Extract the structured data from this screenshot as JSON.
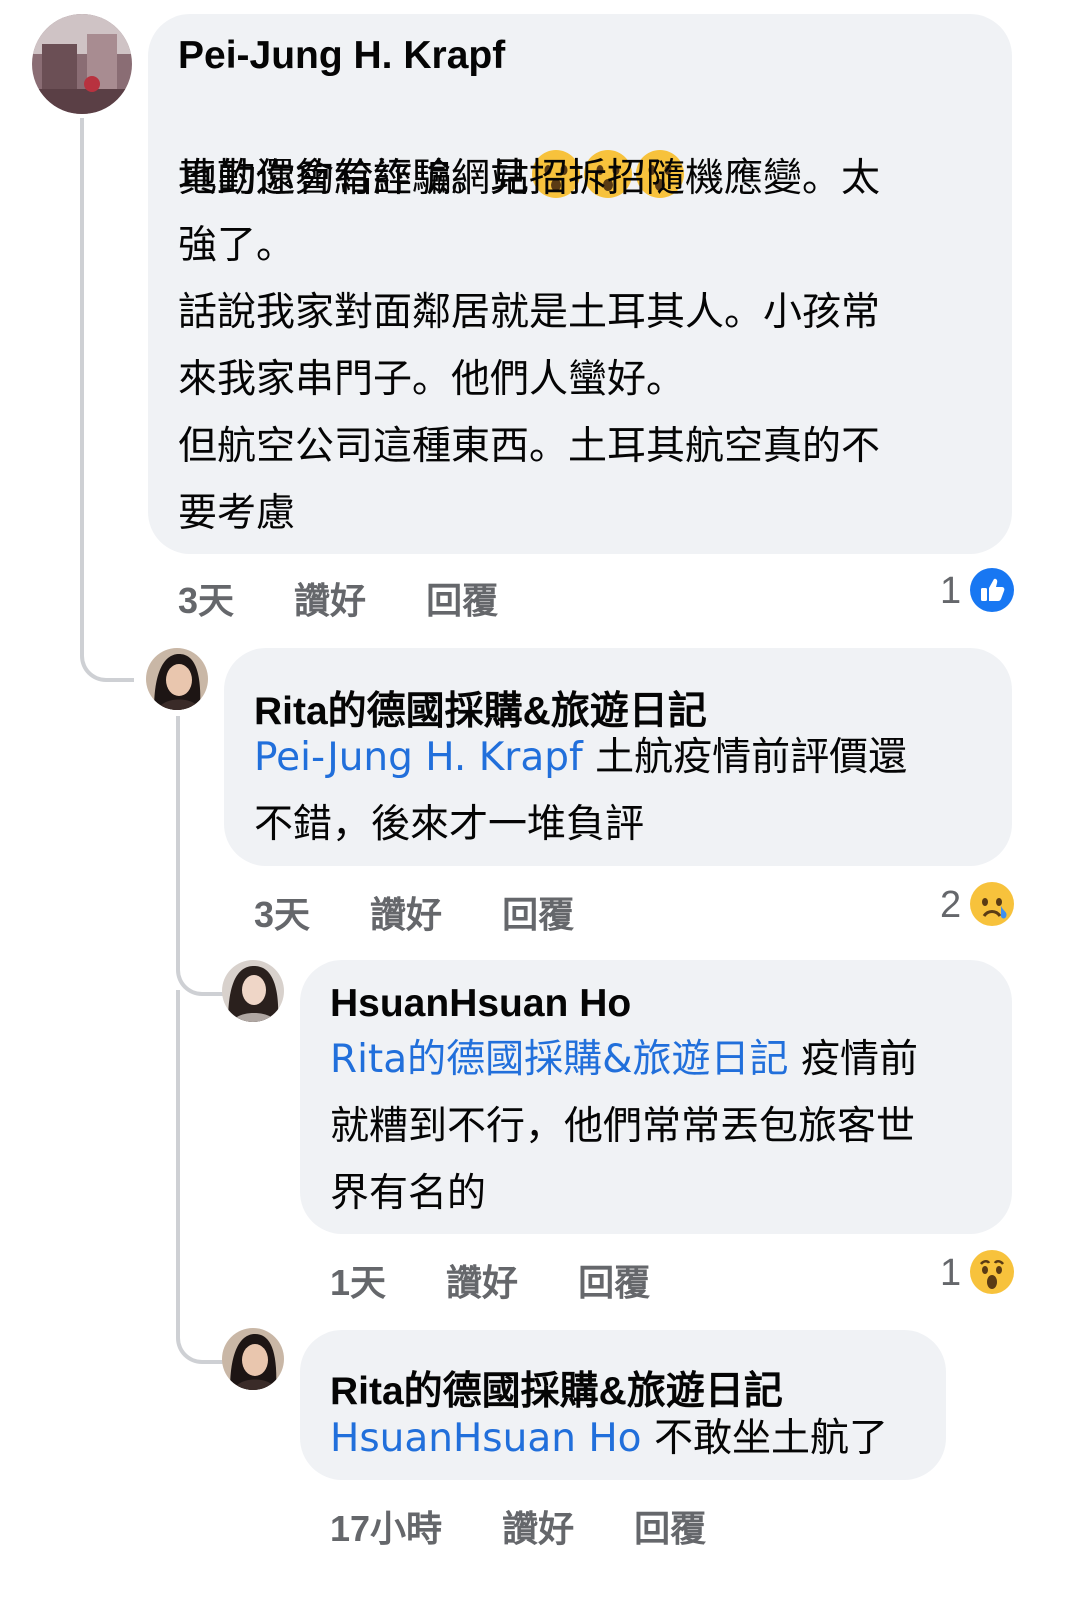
{
  "comments": [
    {
      "author": "Pei-Jung H. Krapf",
      "line1": "地勤還會給詐騙網站",
      "emoji_count": 3,
      "body": "真的你夠有經驗。見招拆招隨機應變。太\n強了。\n話說我家對面鄰居就是土耳其人。小孩常\n來我家串門子。他們人蠻好。\n但航空公司這種東西。土耳其航空真的不\n要考慮",
      "time": "3天",
      "like_label": "讚好",
      "reply_label": "回覆",
      "reaction_count": "1",
      "reaction_icon": "like-icon"
    },
    {
      "author": "Rita的德國採購&旅遊日記",
      "mention": "Pei-Jung H. Krapf",
      "body": " 土航疫情前評價還\n不錯，後來才一堆負評",
      "time": "3天",
      "like_label": "讚好",
      "reply_label": "回覆",
      "reaction_count": "2",
      "reaction_icon": "sad-icon"
    },
    {
      "author": "HsuanHsuan Ho",
      "mention": "Rita的德國採購&旅遊日記",
      "body": " 疫情前\n就糟到不行，他們常常丟包旅客世\n界有名的",
      "time": "1天",
      "like_label": "讚好",
      "reply_label": "回覆",
      "reaction_count": "1",
      "reaction_icon": "wow-icon"
    },
    {
      "author": "Rita的德國採購&旅遊日記",
      "mention": "HsuanHsuan Ho",
      "body": " 不敢坐土航了",
      "time": "17小時",
      "like_label": "讚好",
      "reply_label": "回覆"
    }
  ],
  "colors": {
    "bubble": "#f0f2f5",
    "mention": "#216fdb",
    "meta": "#65676b",
    "like_blue": "#1877f2",
    "emoji_yellow": "#f7c23c"
  }
}
